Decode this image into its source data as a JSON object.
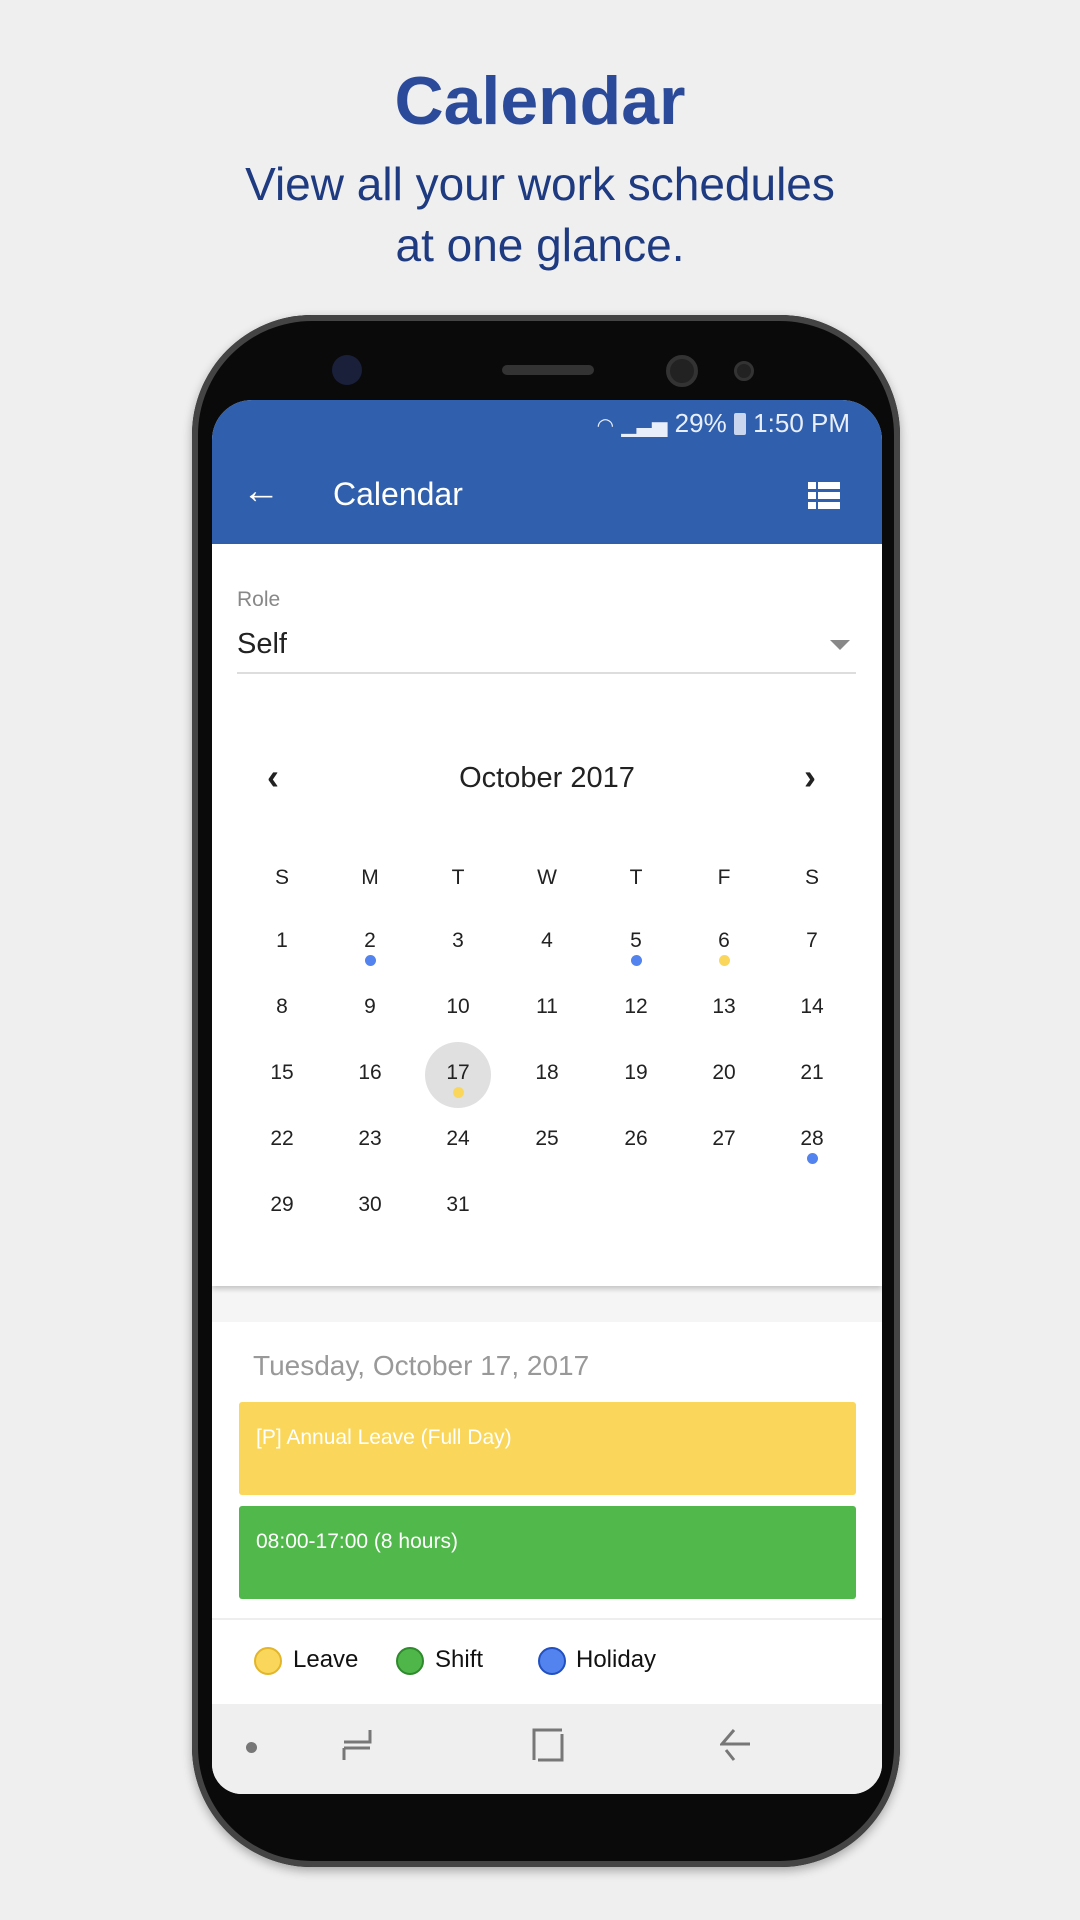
{
  "promo": {
    "title": "Calendar",
    "subtitle_line1": "View all your work schedules",
    "subtitle_line2": "at one glance."
  },
  "status_bar": {
    "battery": "29%",
    "time": "1:50 PM"
  },
  "app_bar": {
    "title": "Calendar",
    "back_icon": "arrow-left-icon",
    "view_icon": "list-view-icon"
  },
  "role": {
    "label": "Role",
    "value": "Self"
  },
  "calendar": {
    "month": "October 2017",
    "weekdays": [
      "S",
      "M",
      "T",
      "W",
      "T",
      "F",
      "S"
    ],
    "start_weekday": 0,
    "days": 31,
    "selected": 17,
    "markers": {
      "2": "holiday",
      "5": "holiday",
      "6": "leave",
      "17": "leave",
      "28": "holiday"
    }
  },
  "details": {
    "date": "Tuesday, October 17, 2017",
    "events": [
      {
        "text": "[P] Annual Leave (Full Day)",
        "type": "leave"
      },
      {
        "text": "08:00-17:00 (8 hours)",
        "type": "shift"
      }
    ]
  },
  "legend": [
    {
      "label": "Leave",
      "color": "#fad75a",
      "border": "#e2b52a"
    },
    {
      "label": "Shift",
      "color": "#4fb64a",
      "border": "#2e8a2c"
    },
    {
      "label": "Holiday",
      "color": "#5283ee",
      "border": "#2350c0"
    }
  ],
  "colors": {
    "leave": "#fad75a",
    "shift": "#51b84b",
    "holiday": "#5283ee",
    "app_bar": "#3060ad"
  }
}
